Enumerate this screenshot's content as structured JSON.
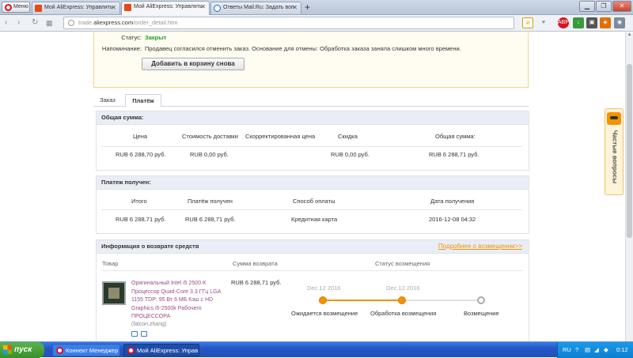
{
  "browser": {
    "menu_label": "Меню",
    "tabs": [
      {
        "label": "Мой AliExpress: Управлять"
      },
      {
        "label": "Мой AliExpress: Управлять"
      },
      {
        "label": "Ответы Mail.Ru: Задать воп"
      }
    ],
    "new_tab": "+",
    "url_prefix": "trade.",
    "url_domain": "aliexpress.com",
    "url_path": "/order_detail.htm"
  },
  "notice": {
    "status_label": "Статус:",
    "status_value": "Закрыт",
    "reminder_label": "Напоминание:",
    "reminder_value": "Продавец согласился отменить заказ. Основание для отмены: Обработка заказа заняла слишком много времени.",
    "add_to_cart": "Добавить в корзину снова"
  },
  "order_tabs": [
    {
      "label": "Заказ"
    },
    {
      "label": "Платёж"
    }
  ],
  "total": {
    "title": "Общая сумма:",
    "columns": [
      "Цена",
      "Стоимость доставки",
      "Скорректированная цена",
      "Скидка",
      "Общая сумма:"
    ],
    "row": [
      "RUB 6 288,70 руб.",
      "RUB 0,00 руб.",
      "",
      "RUB 0,00 руб.",
      "RUB 6 288,71 руб."
    ]
  },
  "payment": {
    "title": "Платеж получен:",
    "columns": [
      "Итого",
      "Платёж получен",
      "Способ оплаты",
      "Дата получения"
    ],
    "row": [
      "RUB 6 288,71 руб.",
      "RUB 6 288,71 руб.",
      "Кредитная карта",
      "2016-12-08 04:32"
    ]
  },
  "refund": {
    "title": "Информация о возврате средств",
    "more_link": "Подробнее о возмещении>>",
    "col_product": "Товар",
    "col_amount": "Сумма возврата",
    "col_status": "Статус возмещения",
    "product_title": "Оригинальный Intel i5 2500 K Процессор Quad-Core 3.3 ГГц LGA 1155 TDP: 95 Вт 6 МБ Кэш с HD Graphics i5-2500k Рабочего ПРОЦЕССОРА",
    "seller": "(falcon.zhang)",
    "amount": "RUB 6 288,71 руб.",
    "steps": [
      {
        "date": "Dec.12 2016",
        "label": "Ожидается возмещение",
        "done": true
      },
      {
        "date": "Dec.12 2016",
        "label": "Обработка возмещения",
        "done": true
      },
      {
        "date": "",
        "label": "Возмещение",
        "done": false
      }
    ]
  },
  "help_widget": {
    "label": "Частые вопросы"
  },
  "taskbar": {
    "start_label": "пуск",
    "items": [
      {
        "label": "Коннект Менеджер"
      },
      {
        "label": "Мой AliExpress: Управ..."
      }
    ],
    "lang": "RU",
    "clock": "0:12"
  }
}
